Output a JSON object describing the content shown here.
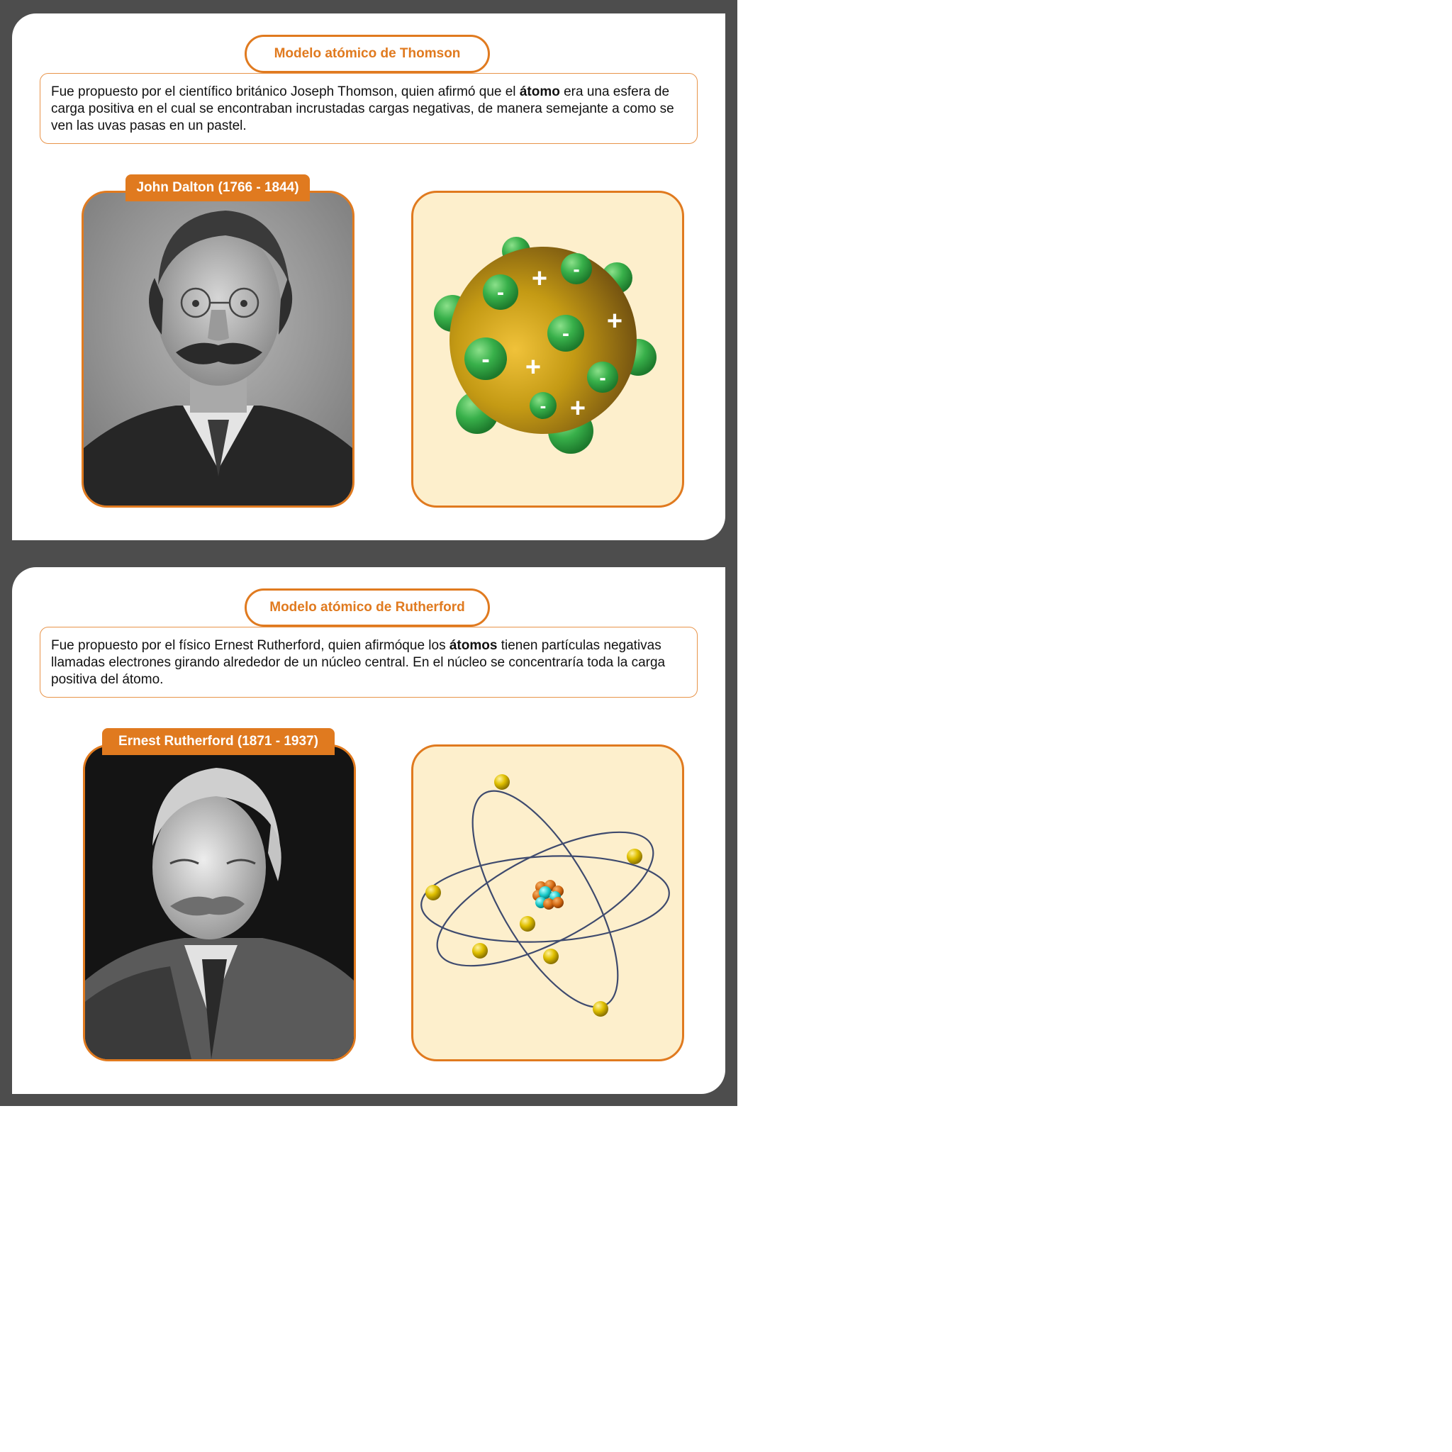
{
  "thomson": {
    "title": "Modelo atómico de Thomson",
    "desc_before": "Fue propuesto por el científico británico Joseph Thomson, quien afirmó que el ",
    "desc_bold": "átomo",
    "desc_after": " era una esfera de carga positiva en el cual se encontraban incrustadas cargas negativas, de manera semejante a como se ven las uvas pasas en un pastel.",
    "photo_label": "John Dalton (1766 - 1844)",
    "plus_sign": "+",
    "minus_sign": "-"
  },
  "rutherford": {
    "title": "Modelo atómico de Rutherford",
    "desc_before": "Fue propuesto por el físico Ernest Rutherford, quien afirmóque los ",
    "desc_bold": "átomos",
    "desc_after": " tienen partículas negativas llamadas electrones girando alrededor de un núcleo central. En el núcleo se concentraría toda la carga positiva del átomo.",
    "photo_label": "Ernest Rutherford (1871 - 1937)"
  },
  "colors": {
    "frame": "#4d4d4d",
    "accent": "#e07a1f",
    "illustration_bg": "#fdefcc",
    "electron_green": "#2fa03c",
    "positive_sphere": "#b8860b",
    "orbit": "#3e4a6e",
    "electron_yellow": "#e0c000"
  }
}
